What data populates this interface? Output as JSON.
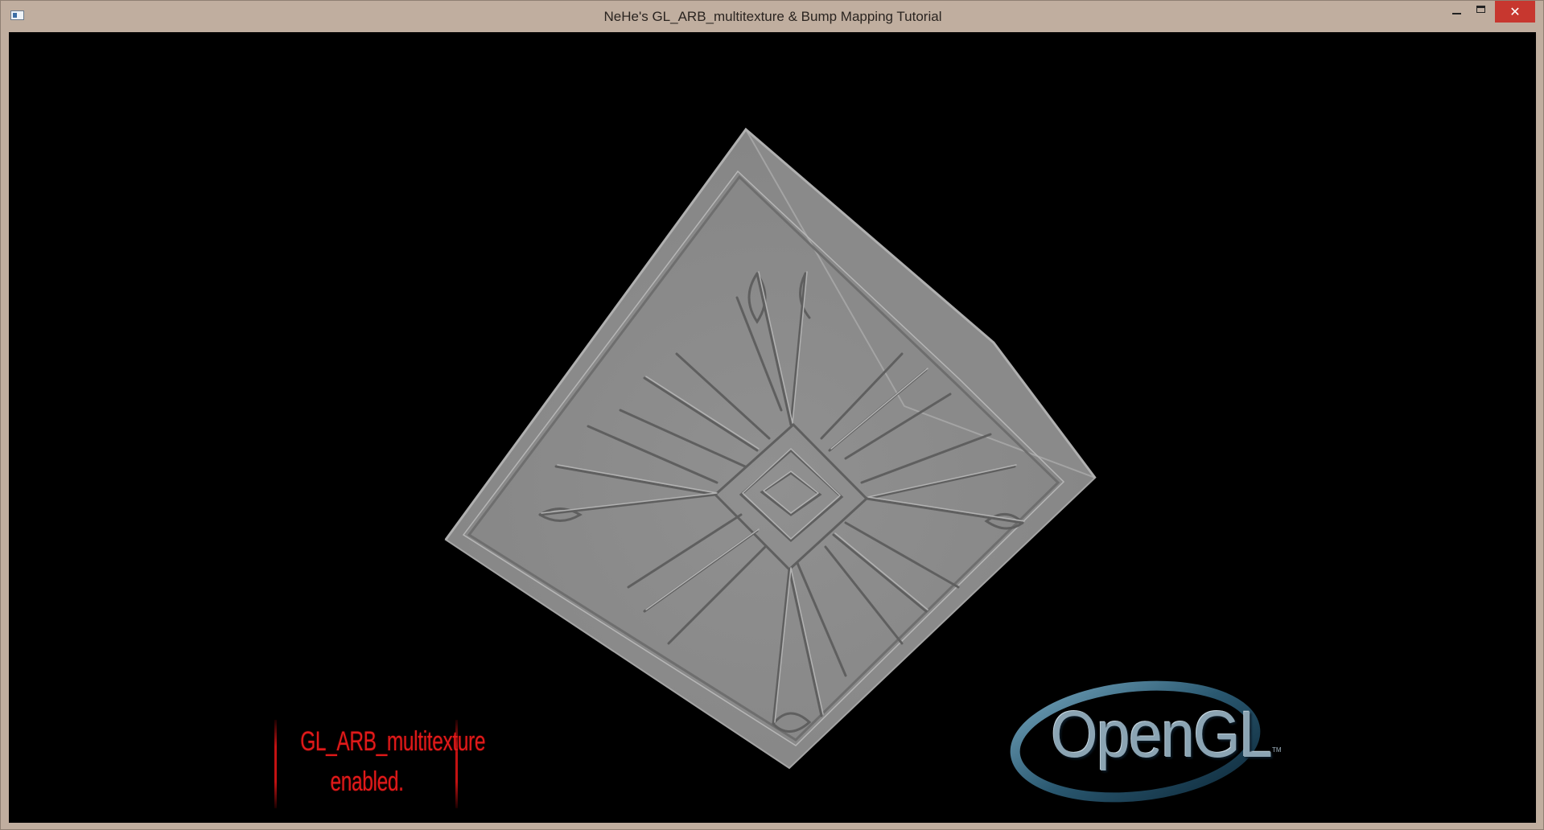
{
  "window": {
    "title": "NeHe's GL_ARB_multitexture & Bump Mapping Tutorial",
    "controls": {
      "close_glyph": "✕"
    }
  },
  "scene": {
    "status_line1": "GL_ARB_multitexture",
    "status_line2": "enabled.",
    "logo_text": "OpenGL",
    "logo_trademark": "TM",
    "colors": {
      "background": "#000000",
      "cube": "#8c8c8c",
      "status_text": "#e01a1a",
      "logo": "#3f6f86"
    }
  }
}
